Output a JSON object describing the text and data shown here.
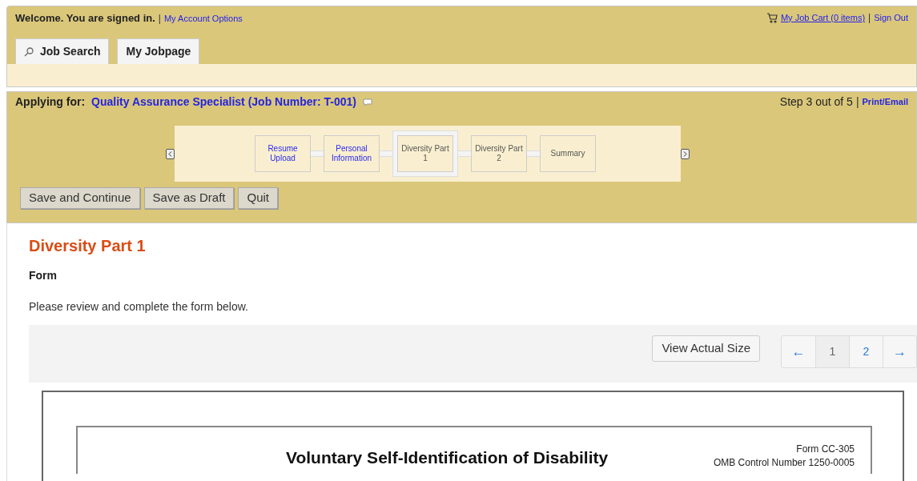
{
  "header": {
    "welcome": "Welcome. You are signed in.",
    "separator": "|",
    "account_link": "My Account Options",
    "cart_link": "My Job Cart (0 items)",
    "separator_2": "|",
    "sign_out": "Sign Out"
  },
  "tabs": [
    {
      "label": "Job Search",
      "kind": "search"
    },
    {
      "label": "My Jobpage",
      "kind": "plain"
    }
  ],
  "application": {
    "label": "Applying for:",
    "job_link": "Quality Assurance Specialist (Job Number: T-001)",
    "step_text": "Step 3 out of 5",
    "separator": "|",
    "print_link": "Print/Email",
    "steps": [
      {
        "label": "Resume Upload",
        "completed": true,
        "selected": false
      },
      {
        "label": "Personal Information",
        "completed": true,
        "selected": false
      },
      {
        "label": "Diversity Part 1",
        "completed": false,
        "selected": true
      },
      {
        "label": "Diversity Part 2",
        "completed": false,
        "selected": false
      },
      {
        "label": "Summary",
        "completed": false,
        "selected": false
      }
    ],
    "buttons": [
      "Save and Continue",
      "Save as Draft",
      "Quit"
    ]
  },
  "content": {
    "heading": "Diversity Part 1",
    "subheading": "Form",
    "instruction": "Please review and complete the form below.",
    "view_button": "View Actual Size",
    "pagination": [
      {
        "label": "←",
        "kind": "arrow",
        "selected": false
      },
      {
        "label": "1",
        "kind": "page",
        "selected": true
      },
      {
        "label": "2",
        "kind": "page",
        "selected": false
      },
      {
        "label": "→",
        "kind": "arrow",
        "selected": false
      }
    ],
    "document": {
      "title": "Voluntary Self-Identification of Disability",
      "form_number": "Form CC-305",
      "omb": "OMB Control Number 1250-0005"
    }
  }
}
